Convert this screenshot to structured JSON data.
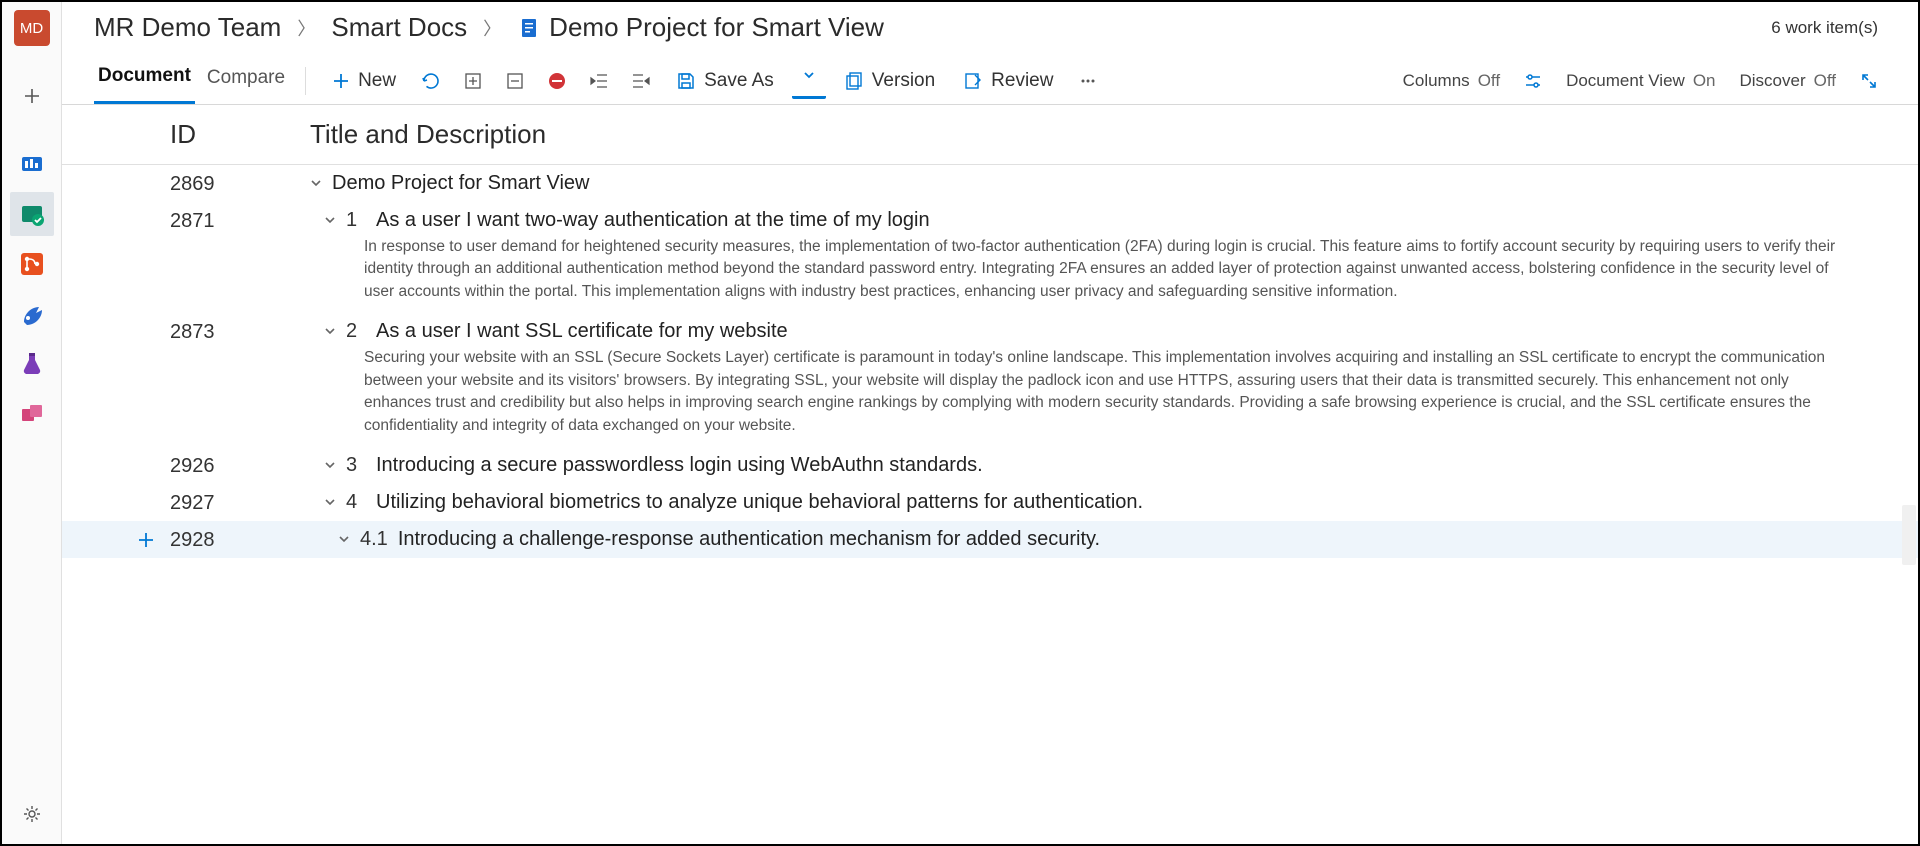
{
  "avatar_initials": "MD",
  "breadcrumb": {
    "team": "MR Demo Team",
    "section": "Smart Docs",
    "project": "Demo Project for Smart View"
  },
  "work_items_count": "6 work item(s)",
  "tabs": {
    "document": "Document",
    "compare": "Compare"
  },
  "toolbar": {
    "new": "New",
    "save_as": "Save As",
    "version": "Version",
    "review": "Review"
  },
  "toggles": {
    "columns_label": "Columns",
    "columns_value": "Off",
    "docview_label": "Document View",
    "docview_value": "On",
    "discover_label": "Discover",
    "discover_value": "Off"
  },
  "columns": {
    "id": "ID",
    "title": "Title and Description"
  },
  "rows": [
    {
      "id": "2869",
      "num": "",
      "title": "Demo Project for Smart View",
      "desc": "",
      "indent": 0,
      "highlight": false,
      "show_add": false
    },
    {
      "id": "2871",
      "num": "1",
      "title": "As a user I want two-way authentication at the time of my login",
      "desc": "In response to user demand for heightened security measures, the implementation of two-factor authentication (2FA) during login is crucial. This feature aims to fortify account security by requiring users to verify their identity through an additional authentication method beyond the standard password entry. Integrating 2FA ensures an added layer of protection against unwanted access, bolstering confidence in the security level of user accounts within the portal. This implementation aligns with industry best practices, enhancing user privacy and safeguarding sensitive information.",
      "indent": 1,
      "highlight": false,
      "show_add": false
    },
    {
      "id": "2873",
      "num": "2",
      "title": "As a user I want SSL certificate for my website",
      "desc": "Securing your website with an SSL (Secure Sockets Layer) certificate is paramount in today's online landscape. This implementation involves acquiring and installing an SSL certificate to encrypt the communication between your website and its visitors' browsers. By integrating SSL, your website will display the padlock icon and use HTTPS, assuring users that their data is transmitted securely. This enhancement not only enhances trust and credibility but also helps in improving search engine rankings by complying with modern security standards. Providing a safe browsing experience is crucial, and the SSL certificate ensures the confidentiality and integrity of data exchanged on your website.",
      "indent": 1,
      "highlight": false,
      "show_add": false
    },
    {
      "id": "2926",
      "num": "3",
      "title": "Introducing a secure passwordless login using WebAuthn standards.",
      "desc": "",
      "indent": 1,
      "highlight": false,
      "show_add": false
    },
    {
      "id": "2927",
      "num": "4",
      "title": "Utilizing behavioral biometrics to analyze unique behavioral patterns for authentication.",
      "desc": "",
      "indent": 1,
      "highlight": false,
      "show_add": false
    },
    {
      "id": "2928",
      "num": "4.1",
      "title": "Introducing a challenge-response authentication mechanism for added security.",
      "desc": "",
      "indent": 2,
      "highlight": true,
      "show_add": true
    }
  ]
}
